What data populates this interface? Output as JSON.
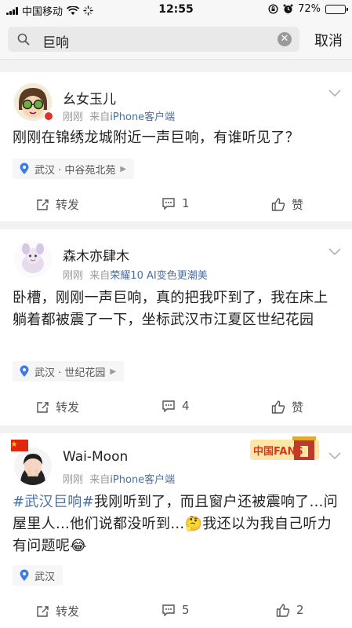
{
  "status_bar": {
    "carrier": "中国移动",
    "time": "12:55",
    "battery": "72%",
    "battery_level": 0.72
  },
  "search": {
    "query": "巨响",
    "cancel_label": "取消"
  },
  "posts": [
    {
      "username": "幺女玉儿",
      "time_label": "刚刚",
      "source_prefix": "来自",
      "source": "iPhone客户端",
      "text": "刚刚在锦绣龙城附近一声巨响，有谁听见了？",
      "location": "武汉 · 中谷苑北苑",
      "repost_label": "转发",
      "comment_count": "1",
      "like_label": "赞"
    },
    {
      "username": "森木亦肆木",
      "time_label": "刚刚",
      "source_prefix": "来自",
      "source": "荣耀10 AI变色更潮美",
      "text": "卧槽，刚刚一声巨响，真的把我吓到了，我在床上躺着都被震了一下，坐标武汉市江夏区世纪花园",
      "location": "武汉 · 世纪花园",
      "repost_label": "转发",
      "comment_count": "4",
      "like_label": "赞"
    },
    {
      "username": "Wai-Moon",
      "time_label": "刚刚",
      "source_prefix": "来自",
      "source": "iPhone客户端",
      "hashtag": "#武汉巨响#",
      "text_part1": "我刚听到了，而且窗户还被震响了…问屋里人…他们说都没听到…",
      "text_part2": "我还以为我自己听力有问题呢",
      "location": "武汉",
      "repost_label": "转发",
      "comment_count": "5",
      "like_count": "2",
      "badge_text": "中国FANS"
    }
  ]
}
